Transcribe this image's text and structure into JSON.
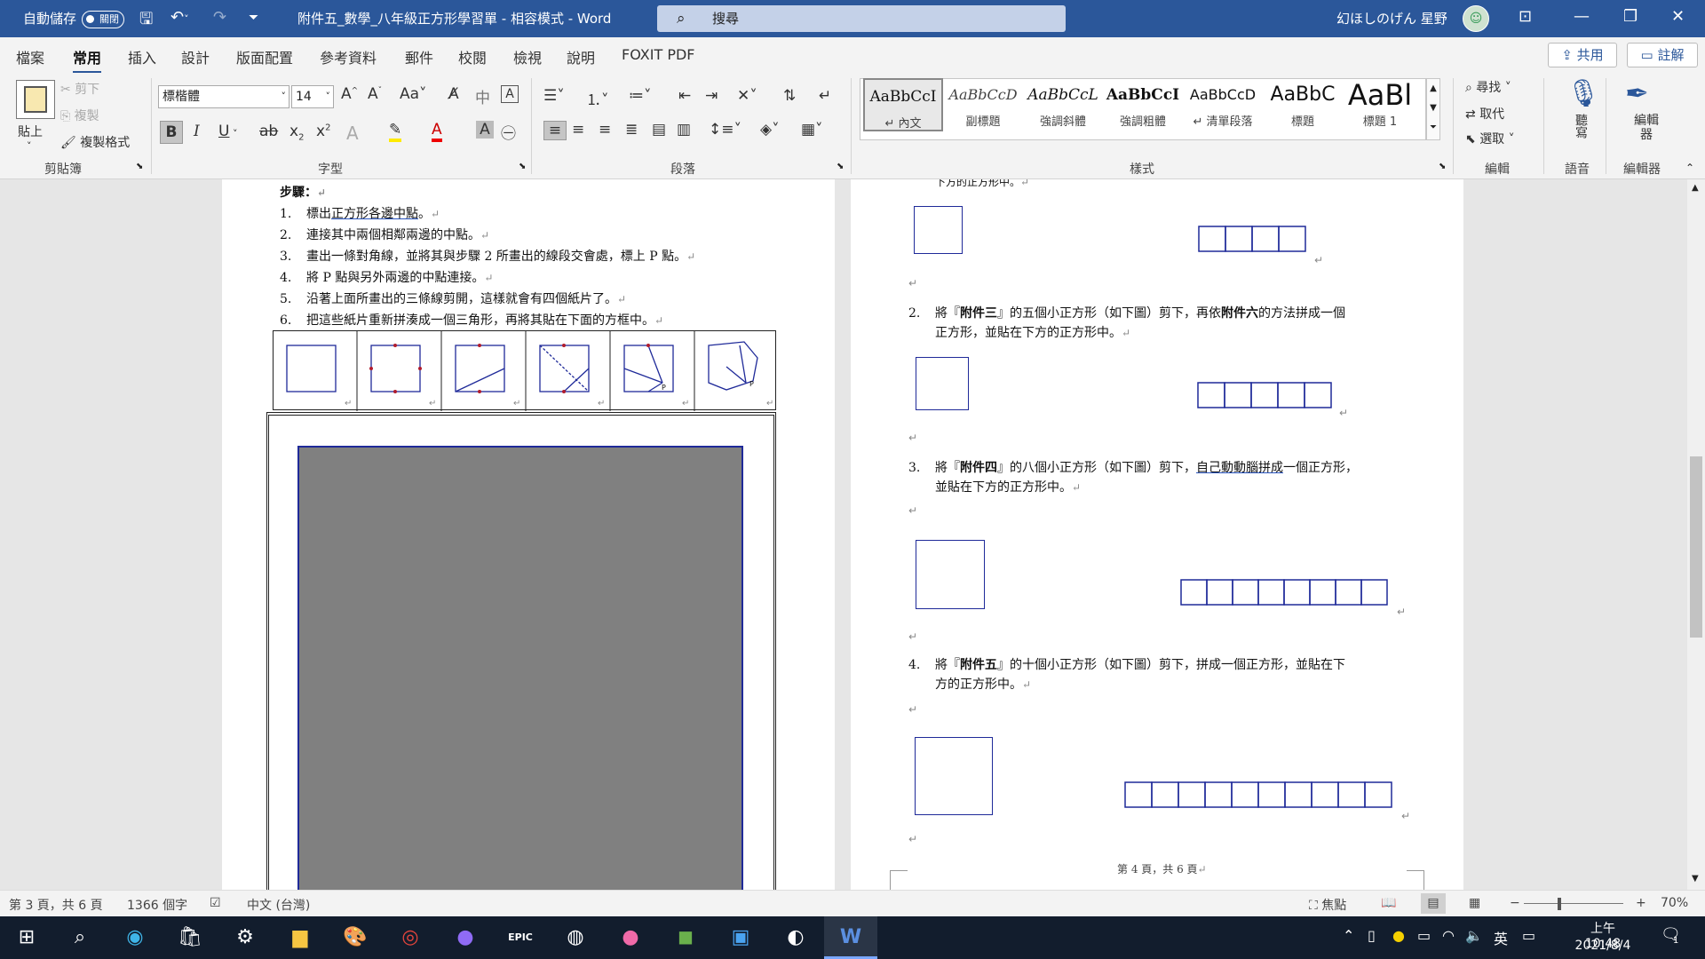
{
  "titlebar": {
    "autosave_label": "自動儲存",
    "autosave_state": "關閉",
    "doc_title": "附件五_數學_八年級正方形學習單  -  相容模式  -  Word",
    "search_placeholder": "搜尋",
    "user_name": "幻ほしのげん 星野"
  },
  "tabs": [
    "檔案",
    "常用",
    "插入",
    "設計",
    "版面配置",
    "參考資料",
    "郵件",
    "校閱",
    "檢視",
    "說明",
    "FOXIT PDF"
  ],
  "share_label": "共用",
  "comment_label": "註解",
  "clipboard": {
    "paste": "貼上",
    "cut": "剪下",
    "copy": "複製",
    "format_painter": "複製格式",
    "group": "剪貼簿"
  },
  "font": {
    "name": "標楷體",
    "size": "14",
    "group": "字型"
  },
  "paragraph": {
    "group": "段落"
  },
  "styles": {
    "items": [
      {
        "preview": "AaBbCcI",
        "name": "內文"
      },
      {
        "preview": "AaBbCcD",
        "name": "副標題"
      },
      {
        "preview": "AaBbCcL",
        "name": "強調斜體"
      },
      {
        "preview": "AaBbCcI",
        "name": "強調粗體"
      },
      {
        "preview": "AaBbCcD",
        "name": "清單段落"
      },
      {
        "preview": "AaBbC",
        "name": "標題"
      },
      {
        "preview": "AaBl",
        "name": "標題 1"
      }
    ],
    "group": "樣式"
  },
  "editing": {
    "find": "尋找",
    "replace": "取代",
    "select": "選取",
    "group": "編輯"
  },
  "voice": {
    "dictate": "聽寫",
    "group": "語音"
  },
  "editor": {
    "label": "編輯器",
    "group": "編輯器"
  },
  "left_page": {
    "steps_heading": "步驟：",
    "steps": [
      {
        "num": "1.",
        "pre": "標出",
        "u": "正方形各邊中點",
        "post": "。"
      },
      {
        "num": "2.",
        "pre": "連接其中兩個相鄰兩邊的中點。",
        "u": "",
        "post": ""
      },
      {
        "num": "3.",
        "pre": "畫出一條對角線，並將其與步驟 2 所畫出的線段交會處，標上 P 點。",
        "u": "",
        "post": ""
      },
      {
        "num": "4.",
        "pre": "將 P 點與另外兩邊的中點連接。",
        "u": "",
        "post": ""
      },
      {
        "num": "5.",
        "pre": "沿著上面所畫出的三條線剪開，這樣就會有四個紙片了。",
        "u": "",
        "post": ""
      },
      {
        "num": "6.",
        "pre": "把這些紙片重新拼湊成一個三角形，再將其貼在下面的方框中。",
        "u": "",
        "post": ""
      }
    ],
    "point_label": "P"
  },
  "right_page": {
    "top_line": "下方的正方形中。",
    "items": [
      {
        "num": "2.",
        "line1_pre": "將『",
        "bold": "附件三",
        "line1_mid": "』的五個小正方形（如下圖）剪下，再依",
        "bold2": "附件六",
        "line1_post": "的方法拼成一個",
        "line2": "正方形，並貼在下方的正方形中。"
      },
      {
        "num": "3.",
        "line1_pre": "將『",
        "bold": "附件四",
        "line1_mid": "』的八個小正方形（如下圖）剪下，",
        "u": "自己動動腦拼成",
        "line1_post": "一個正方形，",
        "line2": "並貼在下方的正方形中。"
      },
      {
        "num": "4.",
        "line1_pre": "將『",
        "bold": "附件五",
        "line1_mid": "』的十個小正方形（如下圖）剪下，拼成一個正方形，並貼在下",
        "line1_post": "",
        "line2": "方的正方形中。"
      }
    ],
    "footer": "第 4 頁，共 6 頁"
  },
  "status": {
    "page": "第 3 頁，共 6 頁",
    "words": "1366 個字",
    "lang": "中文 (台灣)",
    "focus": "焦點",
    "zoom": "70%"
  },
  "taskbar": {
    "ime": "英",
    "time": "上午 10:48",
    "date": "2021/8/4",
    "notif": "1"
  }
}
